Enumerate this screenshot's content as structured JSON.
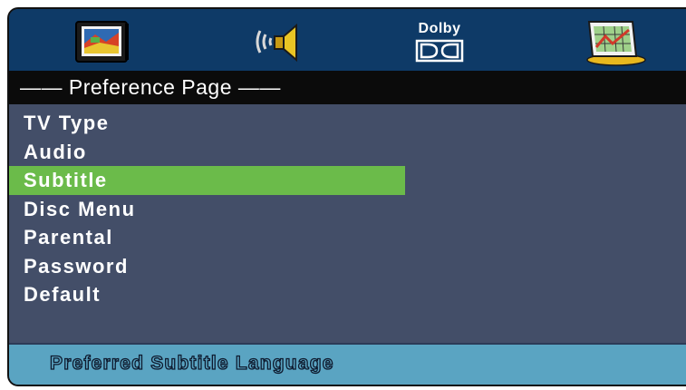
{
  "top_icons": [
    {
      "name": "tv-setup-icon",
      "label": ""
    },
    {
      "name": "speaker-audio-icon",
      "label": ""
    },
    {
      "name": "dolby-icon",
      "label": "Dolby"
    },
    {
      "name": "preference-chart-icon",
      "label": ""
    }
  ],
  "header": {
    "title": "—— Preference Page ——"
  },
  "menu": {
    "items": [
      {
        "label": "TV Type",
        "selected": false
      },
      {
        "label": "Audio",
        "selected": false
      },
      {
        "label": "Subtitle",
        "selected": true
      },
      {
        "label": "Disc Menu",
        "selected": false
      },
      {
        "label": "Parental",
        "selected": false
      },
      {
        "label": "Password",
        "selected": false
      },
      {
        "label": "Default",
        "selected": false
      }
    ]
  },
  "footer": {
    "hint": "Preferred Subtitle Language"
  },
  "colors": {
    "topbar": "#0e3a67",
    "panel": "#434e68",
    "header": "#0b0b0b",
    "selection": "#6bbb4a",
    "footer": "#5aa4c2"
  }
}
